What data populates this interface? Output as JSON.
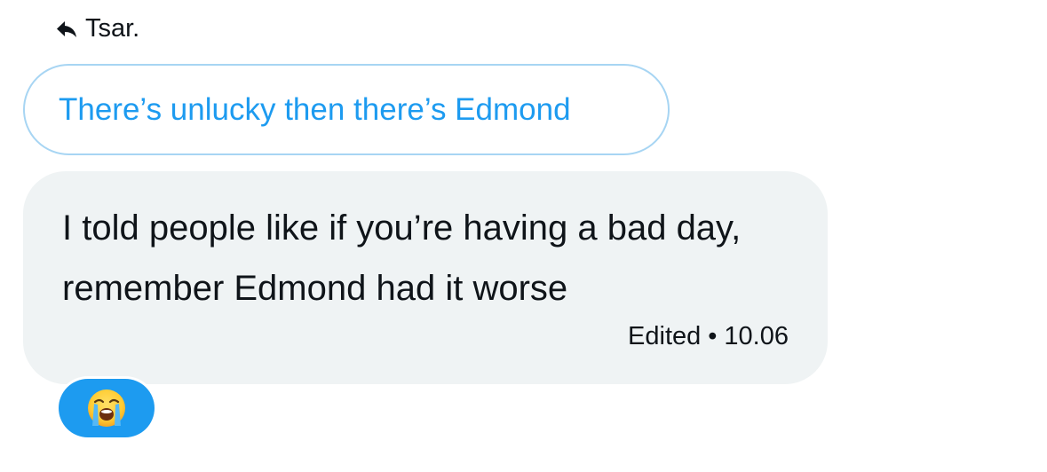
{
  "reply_context": {
    "label": "Tsar.",
    "icon": "reply-arrow-icon"
  },
  "quoted_message": {
    "text": "There’s unlucky then there’s Edmond"
  },
  "message": {
    "text": "I told people like if you’re having a bad day, remember Edmond had it worse",
    "edited_label": "Edited",
    "separator": "•",
    "time": "10.06"
  },
  "reaction": {
    "emoji": "loudly-crying-face-icon"
  },
  "colors": {
    "accent": "#1d9bf0",
    "quoted_border": "#a7d5f3",
    "bubble_bg": "#eff3f4",
    "text": "#0f1419"
  }
}
